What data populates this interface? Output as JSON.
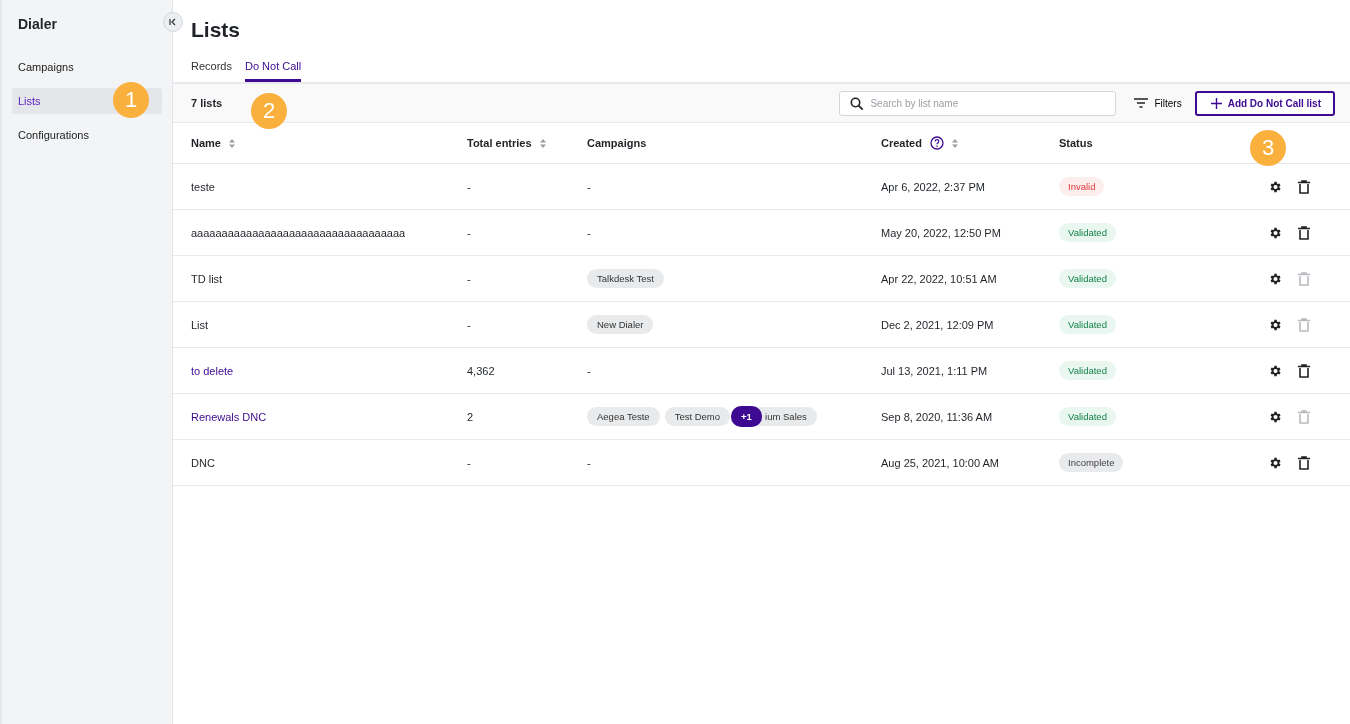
{
  "sidebar": {
    "title": "Dialer",
    "items": [
      {
        "label": "Campaigns",
        "selected": false
      },
      {
        "label": "Lists",
        "selected": true
      },
      {
        "label": "Configurations",
        "selected": false
      }
    ]
  },
  "page": {
    "title": "Lists"
  },
  "tabs": [
    {
      "label": "Records",
      "selected": false
    },
    {
      "label": "Do Not Call",
      "selected": true
    }
  ],
  "toolbar": {
    "count": "7 lists",
    "search": {
      "placeholder": "Search by list name"
    },
    "filters": "Filters",
    "add_button": "Add Do Not Call list"
  },
  "table": {
    "columns": [
      {
        "label": "Name",
        "sortable": true,
        "help": false
      },
      {
        "label": "Total entries",
        "sortable": true,
        "help": false
      },
      {
        "label": "Campaigns",
        "sortable": false,
        "help": false
      },
      {
        "label": "Created",
        "sortable": true,
        "help": true
      },
      {
        "label": "Status",
        "sortable": false,
        "help": false
      }
    ],
    "rows": [
      {
        "name": "teste",
        "link": false,
        "total": "-",
        "campaigns": [],
        "campaigns_empty": "-",
        "created": "Apr 6, 2022, 2:37 PM",
        "status": {
          "label": "Invalid",
          "kind": "invalid"
        },
        "delete_disabled": false
      },
      {
        "name": "aaaaaaaaaaaaaaaaaaaaaaaaaaaaaaaaaaa",
        "link": false,
        "total": "-",
        "campaigns": [],
        "campaigns_empty": "-",
        "created": "May 20, 2022, 12:50 PM",
        "status": {
          "label": "Validated",
          "kind": "validated"
        },
        "delete_disabled": false
      },
      {
        "name": "TD list",
        "link": false,
        "total": "-",
        "campaigns": [
          "Talkdesk Test"
        ],
        "created": "Apr 22, 2022, 10:51 AM",
        "status": {
          "label": "Validated",
          "kind": "validated"
        },
        "delete_disabled": true
      },
      {
        "name": "List",
        "link": false,
        "total": "-",
        "campaigns": [
          "New Dialer"
        ],
        "created": "Dec 2, 2021, 12:09 PM",
        "status": {
          "label": "Validated",
          "kind": "validated"
        },
        "delete_disabled": true
      },
      {
        "name": "to delete",
        "link": true,
        "total": "4,362",
        "campaigns": [],
        "campaigns_empty": "-",
        "created": "Jul 13, 2021, 1:11 PM",
        "status": {
          "label": "Validated",
          "kind": "validated"
        },
        "delete_disabled": false
      },
      {
        "name": "Renewals DNC",
        "link": true,
        "total": "2",
        "campaigns": [
          "Aegea Teste",
          "Test Demo",
          "ium Sales"
        ],
        "more": "+1",
        "created": "Sep 8, 2020, 11:36 AM",
        "status": {
          "label": "Validated",
          "kind": "validated"
        },
        "delete_disabled": true
      },
      {
        "name": "DNC",
        "link": false,
        "total": "-",
        "campaigns": [],
        "campaigns_empty": "-",
        "created": "Aug 25, 2021, 10:00 AM",
        "status": {
          "label": "Incomplete",
          "kind": "incomplete"
        },
        "delete_disabled": false
      }
    ]
  },
  "callouts": [
    {
      "label": "1"
    },
    {
      "label": "2"
    },
    {
      "label": "3"
    }
  ]
}
